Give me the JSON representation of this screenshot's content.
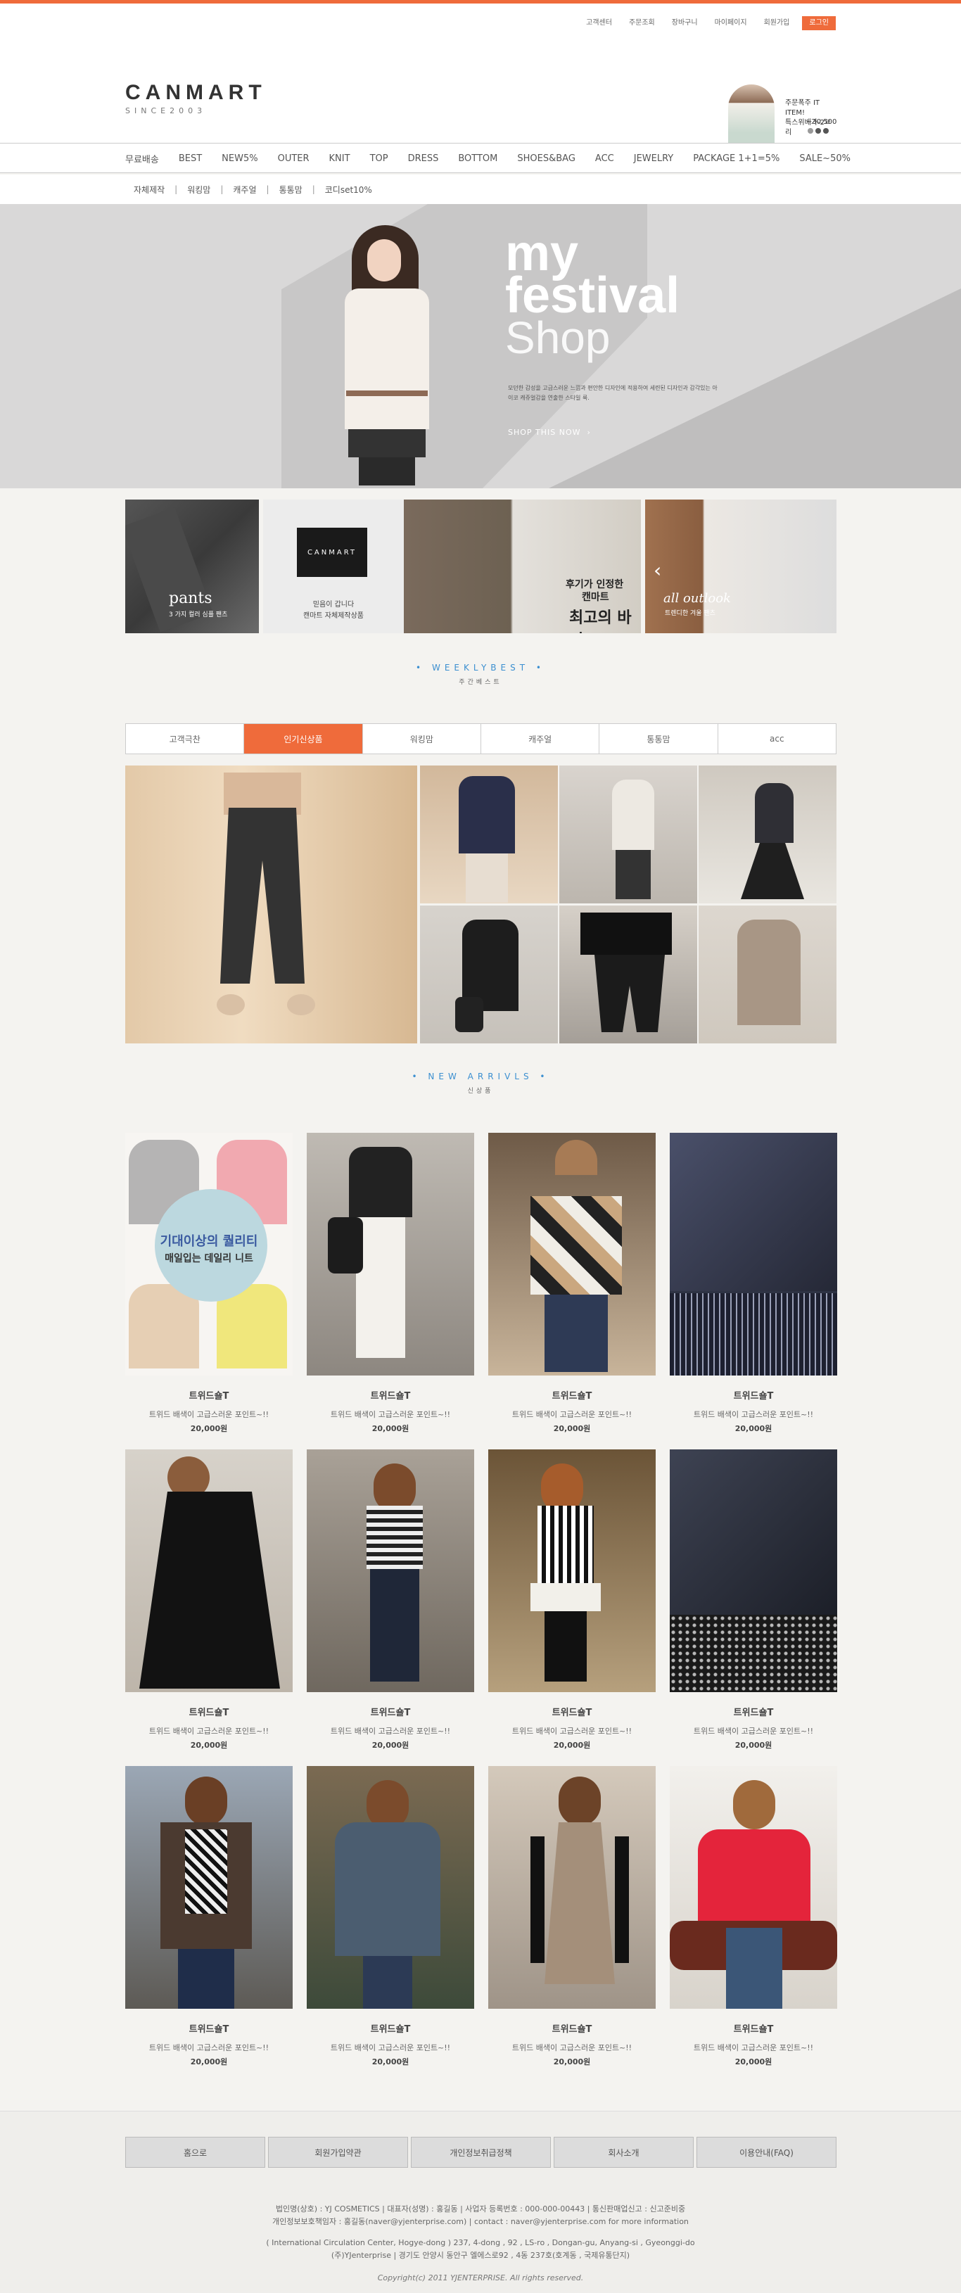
{
  "util": {
    "items": [
      "고객센터",
      "주문조회",
      "장바구니",
      "마이페이지",
      "회원가입"
    ],
    "login": "로그인"
  },
  "logo": {
    "name": "CANMART",
    "since": "SINCE2003"
  },
  "promo": {
    "line1": "주문폭주 IT ITEM!",
    "line2": "특스위베가-2ㄹ리",
    "price": "~30,500"
  },
  "nav": {
    "items": [
      "무료배송",
      "BEST",
      "NEW5%",
      "OUTER",
      "KNIT",
      "TOP",
      "DRESS",
      "BOTTOM",
      "SHOES&BAG",
      "ACC",
      "JEWELRY",
      "PACKAGE 1+1=5%",
      "SALE~50%"
    ]
  },
  "subnav": {
    "items": [
      "자체제작",
      "워킹맘",
      "캐주얼",
      "통통맘",
      "코디set10%"
    ]
  },
  "hero": {
    "title1": "my",
    "title2": "festival",
    "title3": "Shop",
    "desc": "모던한 감성을 고급스러운 느낌과 편안한 디자인에 적용하여 세련된 디자인과 감각있는 아이코 캐쥬얼감을 연출한 스타일 룩.",
    "cta": "SHOP THIS NOW",
    "cta_arrow": "›"
  },
  "banners": [
    {
      "cap1": "pants",
      "cap2": "3 가지 컬러 심플 팬츠"
    },
    {
      "cap1": "CANMART",
      "cap2": "믿음이 갑니다",
      "cap3": "캔마트 자체제작상품"
    },
    {
      "cap1": "후기가 인정한",
      "cap2": "캔마트",
      "cap3": "최고의 바지"
    },
    {
      "cap1": "all outlook",
      "cap2": "트렌디한 겨울 팬츠"
    }
  ],
  "weekly": {
    "en": "WEEKLYBEST",
    "ko": "주간베스트"
  },
  "tabs": [
    "고객극찬",
    "인기신상품",
    "워킹맘",
    "캐주얼",
    "통통맘",
    "acc"
  ],
  "tab_active": 1,
  "newarr": {
    "en": "NEW ARRIVLS",
    "ko": "신상품"
  },
  "products": [
    {
      "name": "트위드숄T",
      "desc": "트위드 배색이 고급스러운 포인트~!!",
      "price": "20,000원",
      "overlay1": "기대이상의 퀄리티",
      "overlay2": "매일입는 데일리 니트"
    },
    {
      "name": "트위드숄T",
      "desc": "트위드 배색이 고급스러운 포인트~!!",
      "price": "20,000원"
    },
    {
      "name": "트위드숄T",
      "desc": "트위드 배색이 고급스러운 포인트~!!",
      "price": "20,000원"
    },
    {
      "name": "트위드숄T",
      "desc": "트위드 배색이 고급스러운 포인트~!!",
      "price": "20,000원"
    },
    {
      "name": "트위드숄T",
      "desc": "트위드 배색이 고급스러운 포인트~!!",
      "price": "20,000원"
    },
    {
      "name": "트위드숄T",
      "desc": "트위드 배색이 고급스러운 포인트~!!",
      "price": "20,000원"
    },
    {
      "name": "트위드숄T",
      "desc": "트위드 배색이 고급스러운 포인트~!!",
      "price": "20,000원"
    },
    {
      "name": "트위드숄T",
      "desc": "트위드 배색이 고급스러운 포인트~!!",
      "price": "20,000원"
    },
    {
      "name": "트위드숄T",
      "desc": "트위드 배색이 고급스러운 포인트~!!",
      "price": "20,000원"
    },
    {
      "name": "트위드숄T",
      "desc": "트위드 배색이 고급스러운 포인트~!!",
      "price": "20,000원"
    },
    {
      "name": "트위드숄T",
      "desc": "트위드 배색이 고급스러운 포인트~!!",
      "price": "20,000원"
    },
    {
      "name": "트위드숄T",
      "desc": "트위드 배색이 고급스러운 포인트~!!",
      "price": "20,000원"
    }
  ],
  "footer": {
    "buttons": [
      "홈으로",
      "회원가입약관",
      "개인정보취급정책",
      "회사소개",
      "이용안내(FAQ)"
    ],
    "info1": "법인명(상호) : YJ COSMETICS | 대표자(성명) : 홍길동 | 사업자 등록번호 : 000-000-00443 | 통신판매업신고 : 신고준비중",
    "info2": "개인정보보호책임자 : 홍길동(naver@yjenterprise.com) | contact : naver@yjenterprise.com for more information",
    "info3": "( International Circulation Center, Hogye-dong ) 237, 4-dong , 92 , LS-ro , Dongan-gu, Anyang-si , Gyeonggi-do",
    "info4": "(주)YJenterprise | 경기도 안양시 동안구 엘에스로92 , 4동 237호(호계동 , 국제유통단지)",
    "copyright": "Copyright(c) 2011 YJENTERPRISE. All rights reserved."
  },
  "colors": {
    "accent": "#ef6b3b",
    "blue": "#3b8fd0"
  }
}
